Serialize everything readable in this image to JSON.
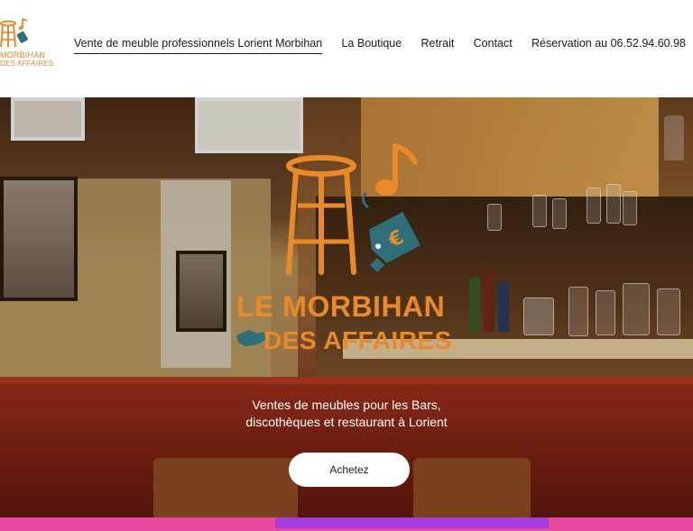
{
  "brand": {
    "line1": "MORBIHAN",
    "line2": "DES AFFAIRES",
    "hero_line1": "LE MORBIHAN",
    "hero_line2": "DES AFFAIRES",
    "color": "#e8892a",
    "accent_teal": "#2e6f7a"
  },
  "nav": {
    "items": [
      {
        "label": "Vente de meuble professionnels Lorient Morbihan",
        "active": true
      },
      {
        "label": "La Boutique"
      },
      {
        "label": "Retrait"
      },
      {
        "label": "Contact"
      },
      {
        "label": "Réservation au 06.52.94.60.98"
      }
    ]
  },
  "hero": {
    "tagline_line1": "Ventes de meubles pour les Bars,",
    "tagline_line2": "discothèques et restaurant à Lorient",
    "cta_label": "Achetez"
  },
  "colors": {
    "strip": "#e64a9c",
    "strip_active": "#a53be0"
  }
}
